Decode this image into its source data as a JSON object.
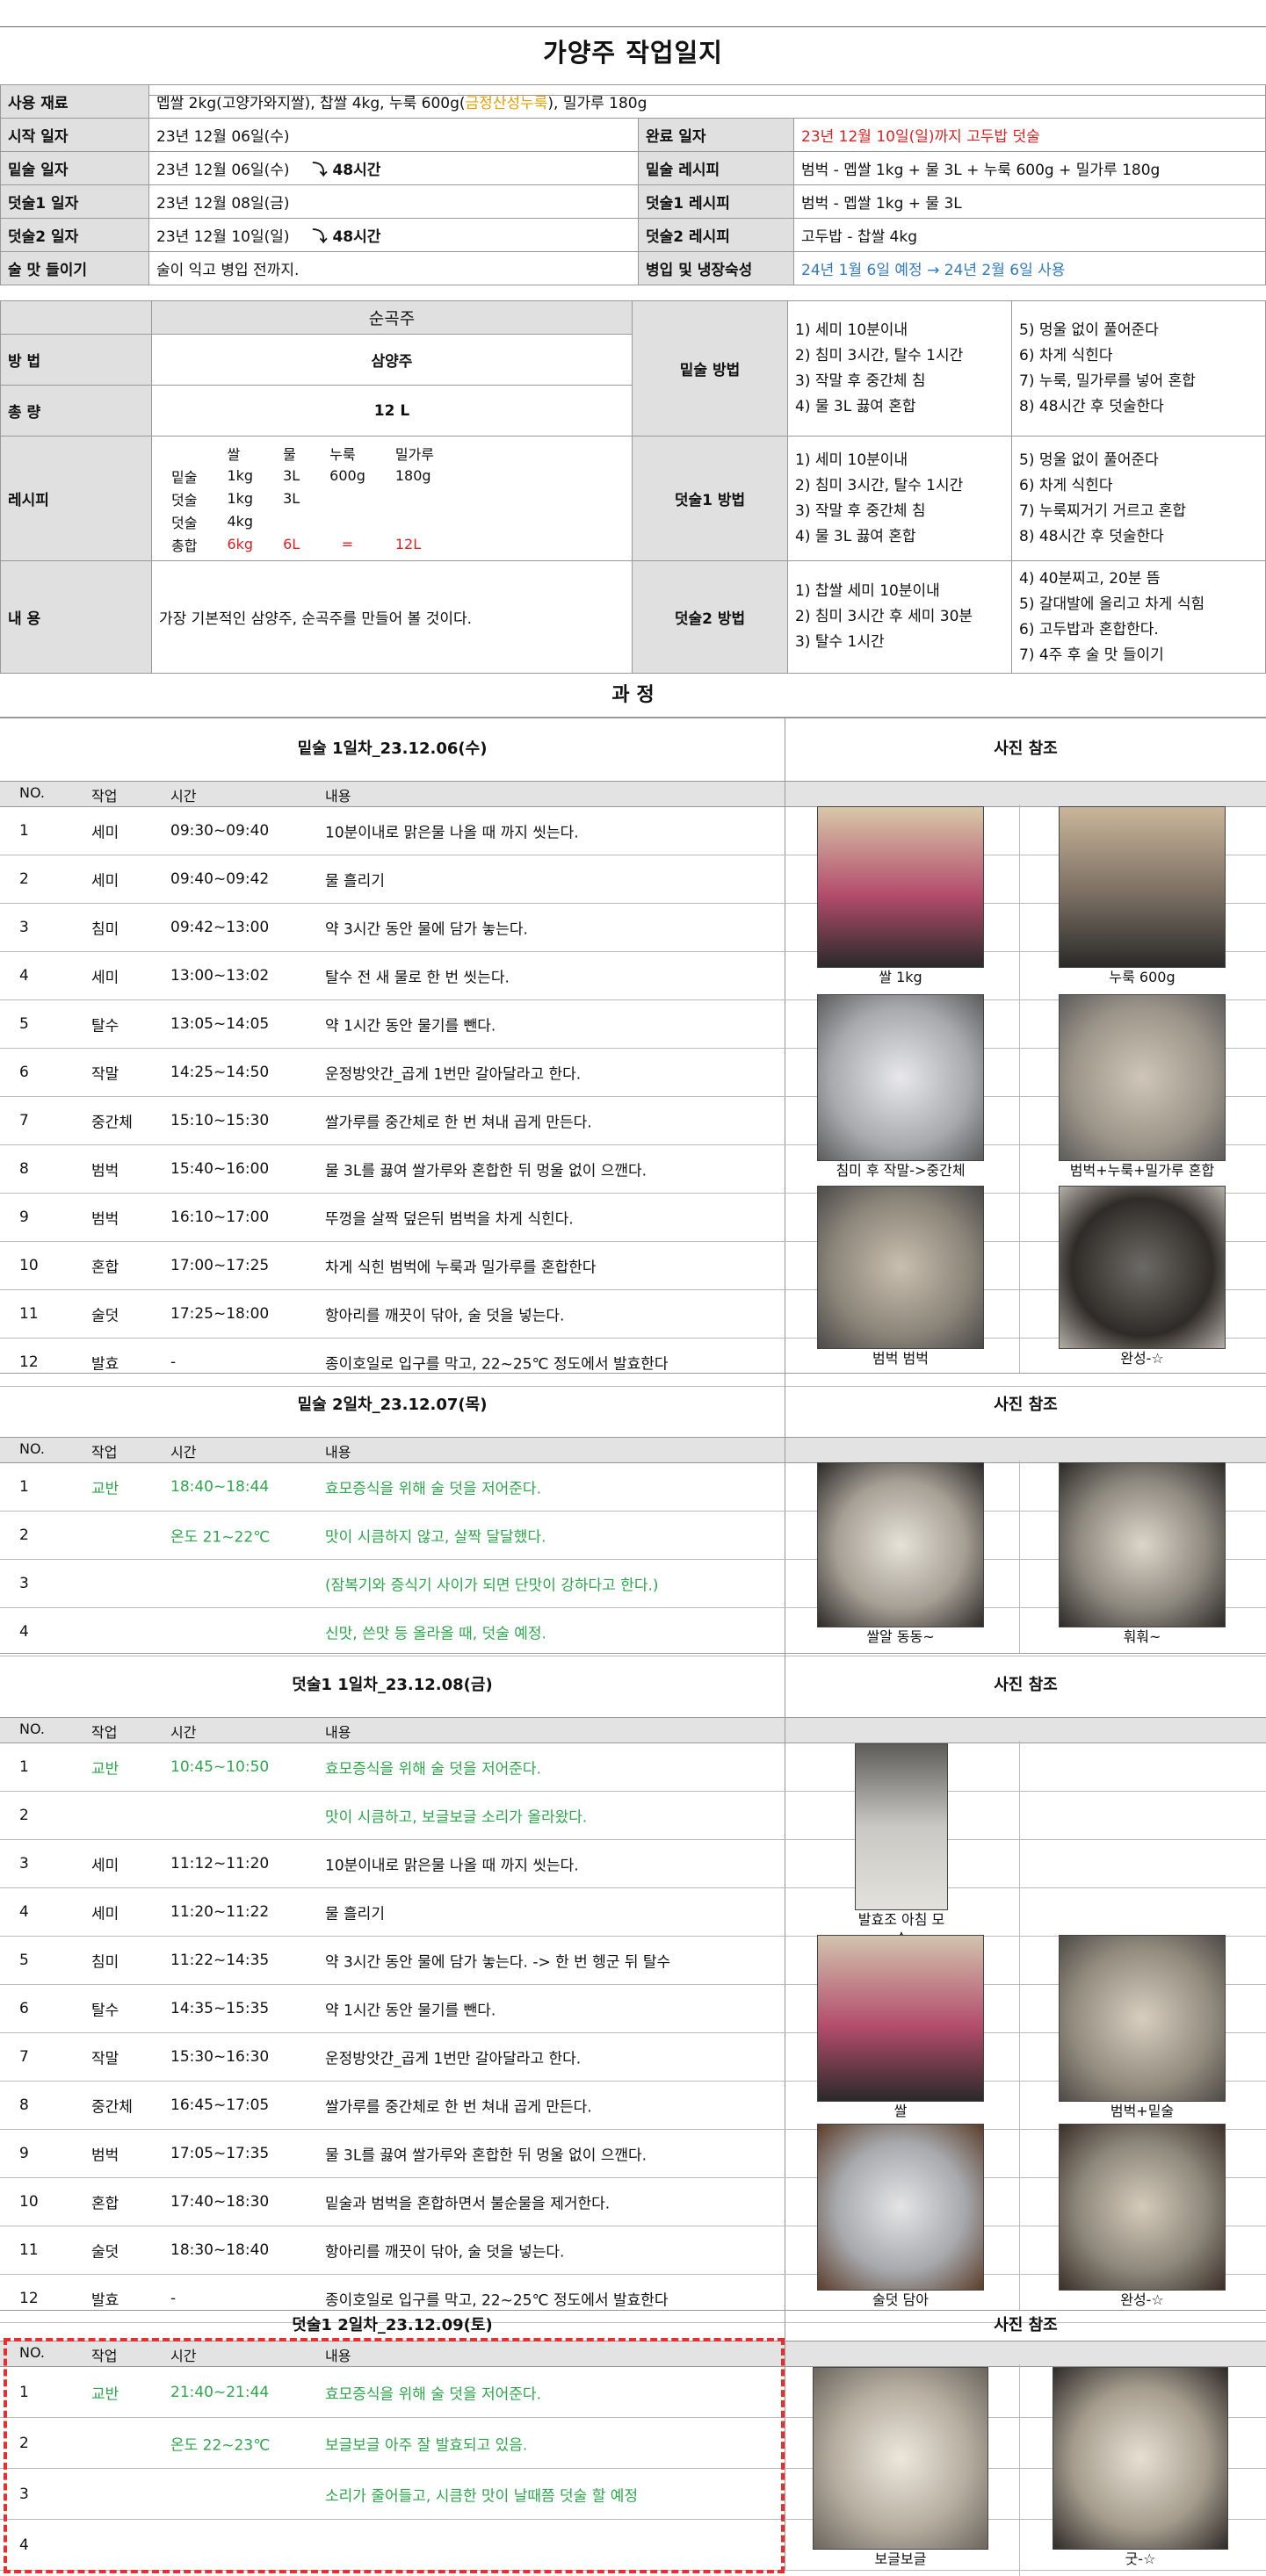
{
  "title": "가양주 작업일지",
  "info": {
    "materials_label": "사용 재료",
    "materials_pre": "멥쌀 2kg(고양가와지쌀), 찹쌀 4kg, 누룩 600g(",
    "materials_brand": "금정산성누룩",
    "materials_post": "), 밀가루 180g",
    "start_label": "시작 일자",
    "start_value": "23년 12월 06일(수)",
    "end_label": "완료 일자",
    "end_value": "23년 12월 10일(일)까지 고두밥 덧술",
    "base_label": "밑술 일자",
    "base_value": "23년 12월 06일(수)",
    "base_recipe_label": "밑술 레시피",
    "base_recipe_value": "범벅 - 멥쌀 1kg + 물 3L + 누룩 600g + 밀가루 180g",
    "add1_label": "덧술1 일자",
    "add1_value": "23년 12월 08일(금)",
    "add1_recipe_label": "덧술1 레시피",
    "add1_recipe_value": "범벅 - 멥쌀 1kg + 물 3L",
    "add2_label": "덧술2 일자",
    "add2_value": "23년 12월 10일(일)",
    "add2_recipe_label": "덧술2 레시피",
    "add2_recipe_value": "고두밥 - 찹쌀 4kg",
    "taste_label": "술 맛 들이기",
    "taste_value": "술이 익고 병입 전까지.",
    "bottle_label": "병입 및 냉장숙성",
    "bottle_value": "24년 1월 6일 예정 → 24년 2월 6일 사용",
    "gap1": "48시간",
    "gap2": "48시간"
  },
  "spec": {
    "kind": "순곡주",
    "method_label": "방 법",
    "method_value": "삼양주",
    "total_label": "총 량",
    "total_value": "12 L",
    "recipe_label": "레시피",
    "recipe_head": [
      "",
      "쌀",
      "물",
      "누룩",
      "밀가루"
    ],
    "recipe_rows": [
      [
        "밑술",
        "1kg",
        "3L",
        "600g",
        "180g"
      ],
      [
        "덧술",
        "1kg",
        "3L",
        "",
        ""
      ],
      [
        "덧술",
        "4kg",
        "",
        "",
        ""
      ]
    ],
    "recipe_total": [
      "총합",
      "6kg",
      "6L",
      "=",
      "12L"
    ],
    "content_label": "내 용",
    "content_value": "가장 기본적인 삼양주, 순곡주를 만들어 볼 것이다.",
    "base_method_label": "밑술 방법",
    "base_steps_a": [
      "1) 세미 10분이내",
      "2) 침미 3시간, 탈수 1시간",
      "3) 작말 후 중간체 침",
      "4) 물 3L 끓여 혼합"
    ],
    "base_steps_b": [
      "5) 멍울 없이 풀어준다",
      "6) 차게 식힌다",
      "7) 누룩, 밀가루를 넣어 혼합",
      "8) 48시간 후 덧술한다"
    ],
    "add1_method_label": "덧술1 방법",
    "add1_steps_a": [
      "1) 세미 10분이내",
      "2) 침미 3시간, 탈수 1시간",
      "3) 작말 후 중간체 침",
      "4) 물 3L 끓여 혼합"
    ],
    "add1_steps_b": [
      "5) 멍울 없이 풀어준다",
      "6) 차게 식힌다",
      "7) 누룩찌거기 거르고 혼합",
      "8) 48시간 후 덧술한다"
    ],
    "add2_method_label": "덧술2 방법",
    "add2_steps_a": [
      "1) 찹쌀 세미 10분이내",
      "2) 침미 3시간 후 세미 30분",
      "3) 탈수 1시간"
    ],
    "add2_steps_b": [
      "4) 40분찌고, 20분 뜸",
      "5) 갈대발에 올리고 차게 식힘",
      "6) 고두밥과 혼합한다.",
      "7) 4주 후 술 맛 들이기"
    ]
  },
  "process_title": "과 정",
  "col_no": "NO.",
  "col_task": "작업",
  "col_time": "시간",
  "col_content": "내용",
  "photo_title": "사진 참조",
  "days": [
    {
      "title": "밑술 1일차_23.12.06(수)",
      "rows": [
        [
          "1",
          "세미",
          "09:30~09:40",
          "10분이내로 맑은물 나올 때 까지 씻는다."
        ],
        [
          "2",
          "세미",
          "09:40~09:42",
          "물 흘리기"
        ],
        [
          "3",
          "침미",
          "09:42~13:00",
          "약 3시간 동안 물에 담가 놓는다."
        ],
        [
          "4",
          "세미",
          "13:00~13:02",
          "탈수 전 새 물로 한 번 씻는다."
        ],
        [
          "5",
          "탈수",
          "13:05~14:05",
          "약 1시간 동안 물기를 뺀다."
        ],
        [
          "6",
          "작말",
          "14:25~14:50",
          "운정방앗간_곱게 1번만 갈아달라고 한다."
        ],
        [
          "7",
          "중간체",
          "15:10~15:30",
          "쌀가루를 중간체로 한 번 쳐내 곱게 만든다."
        ],
        [
          "8",
          "범벅",
          "15:40~16:00",
          "물 3L를 끓여 쌀가루와 혼합한 뒤 멍울 없이 으깬다."
        ],
        [
          "9",
          "범벅",
          "16:10~17:00",
          "뚜껑을 살짝 덮은뒤 범벅을 차게 식힌다."
        ],
        [
          "10",
          "혼합",
          "17:00~17:25",
          "차게 식힌 범벅에 누룩과 밀가루를 혼합한다"
        ],
        [
          "11",
          "술덧",
          "17:25~18:00",
          "항아리를 깨끗이 닦아, 술 덧을 넣는다."
        ],
        [
          "12",
          "발효",
          "-",
          "종이호일로 입구를 막고, 22~25℃ 정도에서 발효한다"
        ]
      ],
      "captions": [
        "쌀 1kg",
        "누룩 600g",
        "침미 후 작말->중간체",
        "범벅+누룩+밀가루 혼합",
        "범벅 범벅",
        "완성-☆"
      ]
    },
    {
      "title": "밑술 2일차_23.12.07(목)",
      "rows": [
        [
          "1",
          "교반",
          "18:40~18:44",
          "효모증식을 위해 술 덧을 저어준다."
        ],
        [
          "2",
          "",
          "온도 21~22℃",
          "맛이 시큼하지 않고, 살짝 달달했다."
        ],
        [
          "3",
          "",
          "",
          "(잠복기와 증식기 사이가 되면 단맛이 강하다고 한다.)"
        ],
        [
          "4",
          "",
          "",
          "신맛, 쓴맛 등 올라올 때, 덧술 예정."
        ]
      ],
      "captions": [
        "쌀알 동동~",
        "훠훠~"
      ]
    },
    {
      "title": "덧술1 1일차_23.12.08(금)",
      "rows": [
        [
          "1",
          "교반",
          "10:45~10:50",
          "효모증식을 위해 술 덧을 저어준다."
        ],
        [
          "2",
          "",
          "",
          "맛이 시큼하고, 보글보글 소리가 올라왔다."
        ],
        [
          "3",
          "세미",
          "11:12~11:20",
          "10분이내로 맑은물 나올 때 까지 씻는다."
        ],
        [
          "4",
          "세미",
          "11:20~11:22",
          "물 흘리기"
        ],
        [
          "5",
          "침미",
          "11:22~14:35",
          "약 3시간 동안 물에 담가 놓는다. -> 한 번 헹군 뒤 탈수"
        ],
        [
          "6",
          "탈수",
          "14:35~15:35",
          "약 1시간 동안 물기를 뺀다."
        ],
        [
          "7",
          "작말",
          "15:30~16:30",
          "운정방앗간_곱게 1번만 갈아달라고 한다."
        ],
        [
          "8",
          "중간체",
          "16:45~17:05",
          "쌀가루를 중간체로 한 번 쳐내 곱게 만든다."
        ],
        [
          "9",
          "범벅",
          "17:05~17:35",
          "물 3L를 끓여 쌀가루와 혼합한 뒤 멍울 없이 으깬다."
        ],
        [
          "10",
          "혼합",
          "17:40~18:30",
          "밑술과 범벅을 혼합하면서 불순물을 제거한다."
        ],
        [
          "11",
          "술덧",
          "18:30~18:40",
          "항아리를 깨끗이 닦아, 술 덧을 넣는다."
        ],
        [
          "12",
          "발효",
          "-",
          "종이호일로 입구를 막고, 22~25℃ 정도에서 발효한다"
        ]
      ],
      "captions": [
        "발효조 아침 모습",
        "쌀",
        "범벅+밑술",
        "술덧 담아",
        "완성-☆"
      ]
    },
    {
      "title": "덧술1 2일차_23.12.09(토)",
      "rows": [
        [
          "1",
          "교반",
          "21:40~21:44",
          "효모증식을 위해 술 덧을 저어준다."
        ],
        [
          "2",
          "",
          "온도 22~23℃",
          "보글보글 아주 잘 발효되고 있음."
        ],
        [
          "3",
          "",
          "",
          "소리가 줄어들고, 시큼한 맛이 날때쯤 덧술 할 예정"
        ],
        [
          "4",
          "",
          "",
          ""
        ]
      ],
      "captions": [
        "보글보글",
        "굿-☆"
      ]
    }
  ],
  "colors": {
    "header_bg": "#e0e0e0",
    "red": "#e02020",
    "blue": "#2f79c4",
    "green": "#2aa84a",
    "orange": "#e8a000",
    "dash": "#e53030"
  }
}
